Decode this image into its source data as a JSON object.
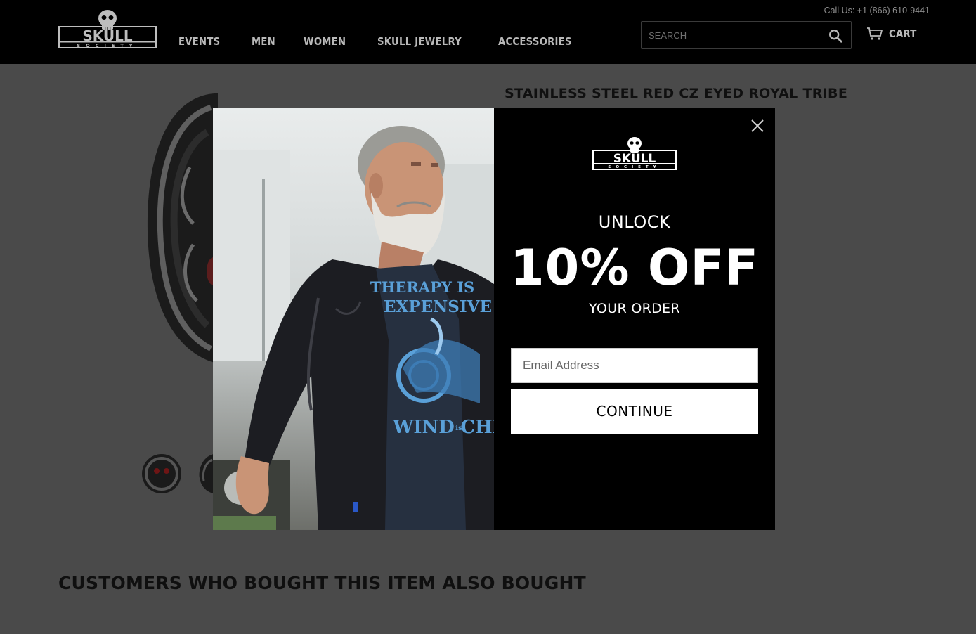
{
  "header": {
    "logo_text": "SKULL",
    "logo_sub": "SOCIETY",
    "nav": [
      "EVENTS",
      "MEN",
      "WOMEN",
      "SKULL JEWELRY",
      "ACCESSORIES"
    ],
    "call_us": "Call Us: +1 (866) 610-9441",
    "search_placeholder": "SEARCH",
    "cart_label": "CART"
  },
  "product": {
    "title": "STAINLESS STEEL RED CZ EYED ROYAL TRIBE"
  },
  "related": {
    "heading": "CUSTOMERS WHO BOUGHT THIS ITEM ALSO BOUGHT"
  },
  "modal": {
    "logo_text": "SKULL",
    "logo_sub": "SOCIETY",
    "unlock": "UNLOCK",
    "discount": "10% OFF",
    "your_order": "YOUR ORDER",
    "email_placeholder": "Email Address",
    "continue_label": "CONTINUE",
    "shirt_line1": "THERAPY IS",
    "shirt_line2": "EXPENSIVE",
    "shirt_line3": "WIND",
    "shirt_line4": "is",
    "shirt_line5": "CHE"
  },
  "icons": [
    "search-icon",
    "cart-icon",
    "close-icon",
    "skull-logo-icon"
  ],
  "colors": {
    "header_bg": "#000000",
    "page_bg": "#4a4a4a",
    "nav_text": "#b8b8b8",
    "modal_bg": "#000000",
    "shirt_print": "#5aa0d8"
  }
}
